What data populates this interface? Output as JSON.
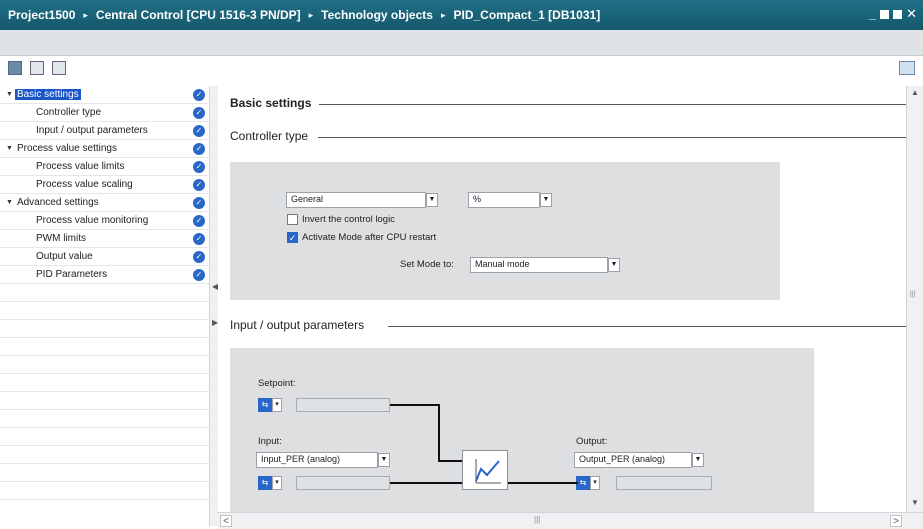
{
  "titlebar": {
    "crumbs": [
      "Project1500",
      "Central Control [CPU 1516-3 PN/DP]",
      "Technology objects",
      "PID_Compact_1 [DB1031]"
    ],
    "separator": "▸",
    "min": "_",
    "close": "✕"
  },
  "nav": {
    "items": [
      {
        "label": "Basic settings",
        "level": 1,
        "expanded": true,
        "selected": true,
        "check": "✓"
      },
      {
        "label": "Controller type",
        "level": 2,
        "check": "✓"
      },
      {
        "label": "Input / output parameters",
        "level": 2,
        "check": "✓"
      },
      {
        "label": "Process value settings",
        "level": 1,
        "expanded": true,
        "check": "✓"
      },
      {
        "label": "Process value limits",
        "level": 2,
        "check": "✓"
      },
      {
        "label": "Process value scaling",
        "level": 2,
        "check": "✓"
      },
      {
        "label": "Advanced settings",
        "level": 1,
        "expanded": true,
        "check": "✓"
      },
      {
        "label": "Process value monitoring",
        "level": 2,
        "check": "✓"
      },
      {
        "label": "PWM limits",
        "level": 2,
        "check": "✓"
      },
      {
        "label": "Output value",
        "level": 2,
        "check": "✓"
      },
      {
        "label": "PID Parameters",
        "level": 2,
        "check": "✓"
      }
    ],
    "expand_glyph": "▼",
    "splitter_arrow_top": "◀",
    "splitter_arrow_bottom": "▶"
  },
  "content": {
    "basic_settings_title": "Basic settings",
    "controller_type_title": "Controller type",
    "io_title": "Input / output parameters",
    "controller": {
      "type_value": "General",
      "unit_value": "%",
      "invert_label": "Invert the control logic",
      "invert_checked": false,
      "activate_label": "Activate Mode after CPU restart",
      "activate_checked": true,
      "checkmark": "✓",
      "set_mode_label": "Set Mode to:",
      "set_mode_value": "Manual mode",
      "dropdown_glyph": "▼"
    },
    "io": {
      "setpoint_label": "Setpoint:",
      "input_label": "Input:",
      "input_value": "Input_PER (analog)",
      "output_label": "Output:",
      "output_value": "Output_PER (analog)",
      "connector_glyph": "⇆",
      "connector_dropdown": "▾"
    }
  },
  "scroll": {
    "up": "▲",
    "down": "▼",
    "left": "<",
    "right": ">",
    "grip": "|||"
  }
}
